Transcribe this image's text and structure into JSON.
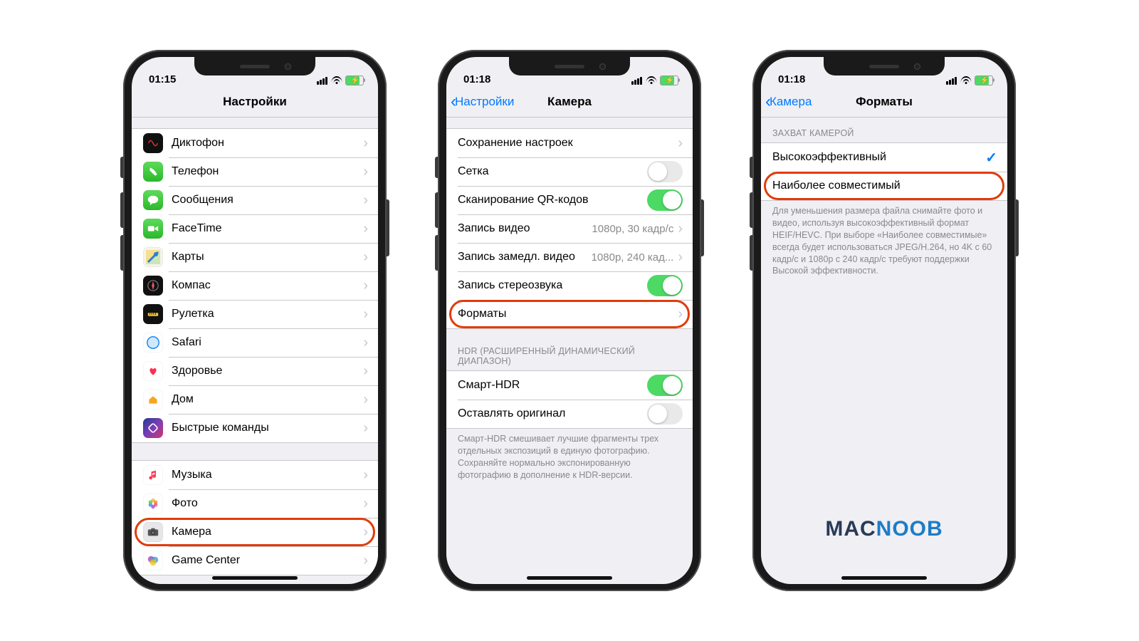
{
  "watermark": {
    "a": "MAC",
    "b": "NOOB"
  },
  "phones": [
    {
      "status_time": "01:15",
      "nav": {
        "title": "Настройки",
        "back": null
      },
      "sections": [
        {
          "items": [
            {
              "icon": "voice",
              "label": "Диктофон"
            },
            {
              "icon": "phone",
              "label": "Телефон"
            },
            {
              "icon": "msg",
              "label": "Сообщения"
            },
            {
              "icon": "ft",
              "label": "FaceTime"
            },
            {
              "icon": "maps",
              "label": "Карты"
            },
            {
              "icon": "compass",
              "label": "Компас"
            },
            {
              "icon": "measure",
              "label": "Рулетка"
            },
            {
              "icon": "safari",
              "label": "Safari"
            },
            {
              "icon": "health",
              "label": "Здоровье"
            },
            {
              "icon": "home",
              "label": "Дом"
            },
            {
              "icon": "short",
              "label": "Быстрые команды"
            }
          ]
        },
        {
          "items": [
            {
              "icon": "music",
              "label": "Музыка"
            },
            {
              "icon": "photos",
              "label": "Фото"
            },
            {
              "icon": "camera",
              "label": "Камера",
              "highlight": true
            },
            {
              "icon": "gc",
              "label": "Game Center"
            }
          ]
        }
      ]
    },
    {
      "status_time": "01:18",
      "nav": {
        "title": "Камера",
        "back": "Настройки"
      },
      "sections": [
        {
          "items": [
            {
              "type": "link",
              "label": "Сохранение настроек"
            },
            {
              "type": "switch",
              "label": "Сетка",
              "on": false
            },
            {
              "type": "switch",
              "label": "Сканирование QR-кодов",
              "on": true
            },
            {
              "type": "value",
              "label": "Запись видео",
              "value": "1080p, 30 кадр/с"
            },
            {
              "type": "value",
              "label": "Запись замедл. видео",
              "value": "1080p, 240 кад..."
            },
            {
              "type": "switch",
              "label": "Запись стереозвука",
              "on": true
            },
            {
              "type": "link",
              "label": "Форматы",
              "highlight": true
            }
          ]
        },
        {
          "header": "HDR (РАСШИРЕННЫЙ ДИНАМИЧЕСКИЙ ДИАПАЗОН)",
          "items": [
            {
              "type": "switch",
              "label": "Смарт-HDR",
              "on": true
            },
            {
              "type": "switch",
              "label": "Оставлять оригинал",
              "on": false
            }
          ],
          "footer": "Смарт-HDR смешивает лучшие фрагменты трех отдельных экспозиций в единую фотографию. Сохраняйте нормально экспонированную фотографию в дополнение к HDR-версии."
        }
      ]
    },
    {
      "status_time": "01:18",
      "nav": {
        "title": "Форматы",
        "back": "Камера"
      },
      "sections": [
        {
          "header": "ЗАХВАТ КАМЕРОЙ",
          "items": [
            {
              "type": "check",
              "label": "Высокоэффективный",
              "checked": true
            },
            {
              "type": "check",
              "label": "Наиболее совместимый",
              "checked": false,
              "highlight": true
            }
          ],
          "footer": "Для уменьшения размера файла снимайте фото и видео, используя высокоэффективный формат HEIF/HEVC. При выборе «Наиболее совместимые» всегда будет использоваться JPEG/H.264, но 4K с 60 кадр/с и 1080p с 240 кадр/с требуют поддержки Высокой эффективности."
        }
      ],
      "watermark": true
    }
  ]
}
